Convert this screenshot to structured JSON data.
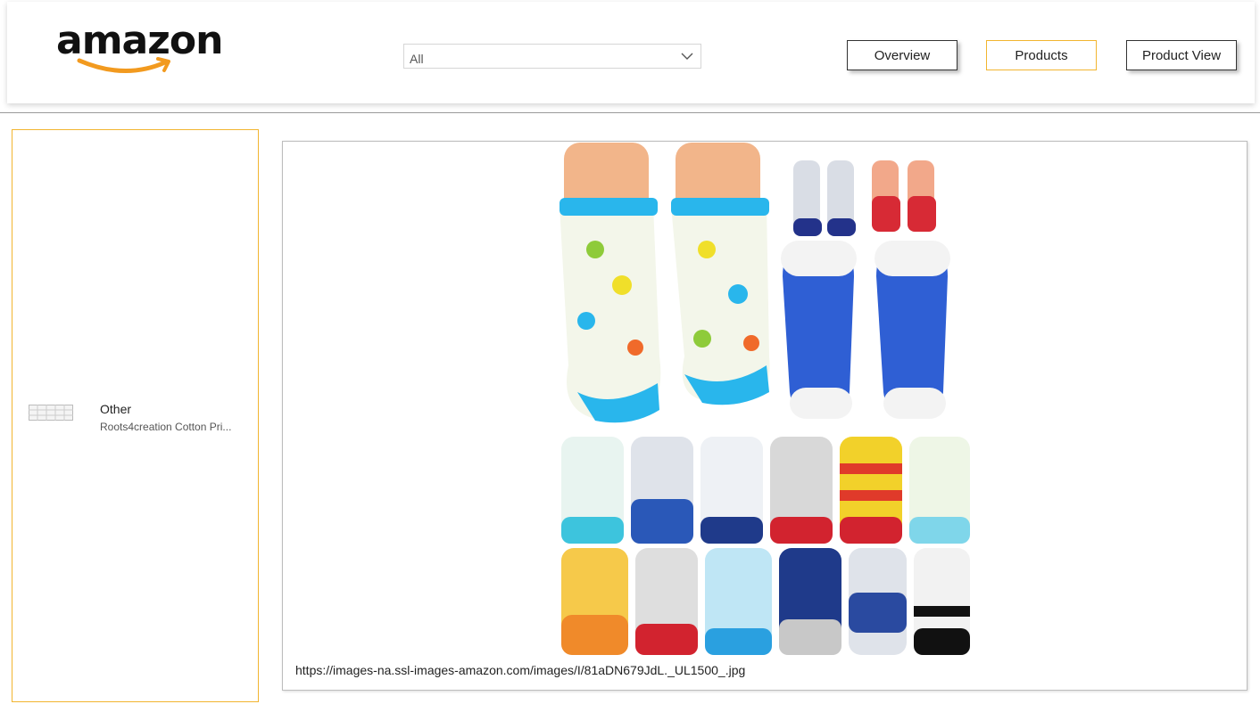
{
  "header": {
    "logo_text": "amazon",
    "dropdown": {
      "value": "All"
    },
    "nav": {
      "overview": "Overview",
      "products": "Products",
      "product_view": "Product View"
    }
  },
  "sidebar": {
    "items": [
      {
        "title": "Other",
        "subtitle": "Roots4creation Cotton Pri..."
      }
    ]
  },
  "viewer": {
    "image_url": "https://images-na.ssl-images-amazon.com/images/I/81aDN679JdL._UL1500_.jpg"
  },
  "colors": {
    "accent": "#f2b530",
    "logo_smile": "#f29a1f",
    "text": "#222222"
  }
}
